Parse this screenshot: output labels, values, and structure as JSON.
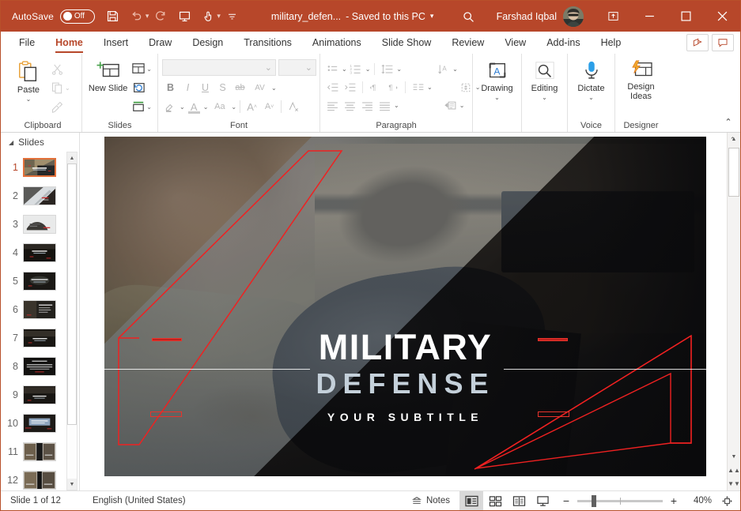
{
  "titlebar": {
    "autosave_label": "AutoSave",
    "autosave_state": "Off",
    "doc_name": "military_defen...",
    "save_state": "- Saved to this PC",
    "user_name": "Farshad Iqbal",
    "icons": {
      "save": "save-icon",
      "undo": "undo-icon",
      "redo": "redo-icon",
      "start_slideshow": "start-slideshow-icon",
      "touch_mode": "touch-mode-icon",
      "customize_qat": "customize-quick-access-toolbar-icon",
      "search": "search-icon",
      "ribbon_display": "ribbon-display-options-icon",
      "minimize": "minimize-icon",
      "maximize": "maximize-icon",
      "close": "close-icon"
    },
    "accent_color": "#b7472a"
  },
  "ribbon": {
    "tabs": [
      {
        "label": "File",
        "active": false
      },
      {
        "label": "Home",
        "active": true
      },
      {
        "label": "Insert",
        "active": false
      },
      {
        "label": "Draw",
        "active": false
      },
      {
        "label": "Design",
        "active": false
      },
      {
        "label": "Transitions",
        "active": false
      },
      {
        "label": "Animations",
        "active": false
      },
      {
        "label": "Slide Show",
        "active": false
      },
      {
        "label": "Review",
        "active": false
      },
      {
        "label": "View",
        "active": false
      },
      {
        "label": "Add-ins",
        "active": false
      },
      {
        "label": "Help",
        "active": false
      }
    ],
    "tab_right_buttons": [
      {
        "name": "share-button",
        "icon": "share-icon"
      },
      {
        "name": "comments-button",
        "icon": "comment-icon"
      }
    ],
    "groups": {
      "clipboard": {
        "label": "Clipboard",
        "paste_label": "Paste",
        "cut_label": "Cut",
        "copy_label": "Copy",
        "format_painter_label": "Format Painter"
      },
      "slides": {
        "label": "Slides",
        "new_slide_label": "New Slide",
        "layout_label": "Layout",
        "reset_label": "Reset",
        "section_label": "Section"
      },
      "font": {
        "label": "Font",
        "font_name_value": "",
        "font_size_value": "",
        "bold": "B",
        "italic": "I",
        "underline": "U",
        "shadow": "S",
        "strikethrough": "ab",
        "char_spacing": "AV",
        "text_highlight": "text-highlight-icon",
        "font_color": "A",
        "change_case": "Aa",
        "increase_size": "A",
        "decrease_size": "A",
        "clear_formatting": "clear-formatting-icon"
      },
      "paragraph": {
        "label": "Paragraph",
        "bullets": "bullets-icon",
        "numbering": "numbering-icon",
        "line_spacing": "line-spacing-icon",
        "text_direction": "text-direction-icon",
        "decrease_indent": "decrease-indent-icon",
        "increase_indent": "increase-indent-icon",
        "ltr": "left-to-right-icon",
        "rtl": "right-to-left-icon",
        "columns": "columns-icon",
        "align_text": "align-text-icon",
        "align_left": "align-left-icon",
        "align_center": "align-center-icon",
        "align_right": "align-right-icon",
        "justify": "justify-icon",
        "convert_smartart": "convert-to-smartart-icon"
      },
      "drawing": {
        "label": "Drawing",
        "button_label": "Drawing"
      },
      "editing": {
        "label": "Editing",
        "button_label": "Editing"
      },
      "voice": {
        "label": "Voice",
        "button_label": "Dictate"
      },
      "designer": {
        "label": "Designer",
        "button_label": "Design Ideas"
      }
    },
    "collapse_label": "collapse-ribbon-icon"
  },
  "thumbnails": {
    "header_label": "Slides",
    "selected_index": 1,
    "slides": [
      {
        "number": "1",
        "style": "title"
      },
      {
        "number": "2",
        "style": "diagonal"
      },
      {
        "number": "3",
        "style": "light"
      },
      {
        "number": "4",
        "style": "dark-text"
      },
      {
        "number": "5",
        "style": "dark-center"
      },
      {
        "number": "6",
        "style": "dark-list"
      },
      {
        "number": "7",
        "style": "dark-text"
      },
      {
        "number": "8",
        "style": "dark-lines"
      },
      {
        "number": "9",
        "style": "dark-text"
      },
      {
        "number": "10",
        "style": "blue-box"
      },
      {
        "number": "11",
        "style": "two-photo"
      },
      {
        "number": "12",
        "style": "two-photo"
      }
    ]
  },
  "slide": {
    "title_line1": "MILITARY",
    "title_line2": "DEFENSE",
    "subtitle": "YOUR SUBTITLE",
    "accent_red": "#ef2121",
    "band_color": "#7e8d9c",
    "subtitle_color": "#ffffff",
    "title2_color": "#c4d0da"
  },
  "statusbar": {
    "slide_counter": "Slide 1 of 12",
    "language": "English (United States)",
    "notes_label": "Notes",
    "views": [
      {
        "name": "normal-view-button",
        "icon": "normal-view-icon",
        "active": true
      },
      {
        "name": "slide-sorter-button",
        "icon": "slide-sorter-icon",
        "active": false
      },
      {
        "name": "reading-view-button",
        "icon": "reading-view-icon",
        "active": false
      },
      {
        "name": "slideshow-button",
        "icon": "slideshow-icon",
        "active": false
      }
    ],
    "zoom_out_label": "−",
    "zoom_in_label": "+",
    "zoom_percent": "40%",
    "fit_label": "fit-slide-to-window-icon"
  }
}
